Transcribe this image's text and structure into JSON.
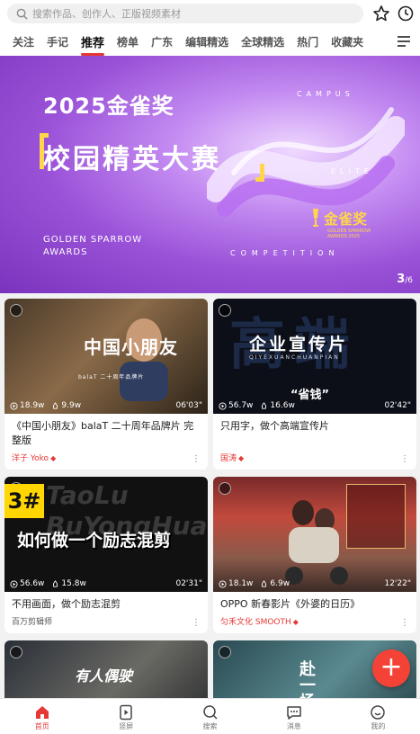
{
  "search": {
    "placeholder": "搜索作品、创作人、正版视频素材"
  },
  "tabs": [
    {
      "label": "关注"
    },
    {
      "label": "手记"
    },
    {
      "label": "推荐"
    },
    {
      "label": "榜单"
    },
    {
      "label": "广东"
    },
    {
      "label": "编辑精选"
    },
    {
      "label": "全球精选"
    },
    {
      "label": "热门"
    },
    {
      "label": "收藏夹"
    }
  ],
  "active_tab": "推荐",
  "banner": {
    "year_title": "2025金雀奖",
    "main_title": "校园精英大赛",
    "en_line1": "GOLDEN SPARROW",
    "en_line2": "AWARDS",
    "campus": "CAMPUS",
    "elite": "ELITE",
    "competition": "COMPETITION",
    "logo_cn": "金雀奖",
    "logo_en1": "GOLDEN SPARROW",
    "logo_en2": "AWARDS·2025",
    "page_current": "3",
    "page_total": "/6"
  },
  "cards": [
    {
      "overlay": "中国小朋友",
      "overlay_sub": "balaT 二十周年品牌片",
      "views": "18.9w",
      "likes": "9.9w",
      "duration": "06'03\"",
      "title": "《中国小朋友》balaT 二十周年品牌片 完整版",
      "author": "洋子 Yoko",
      "author_badge": true
    },
    {
      "overlay": "企业宣传片",
      "overlay_sub": "QIYEXUANCHUANPIAN",
      "overlay_big": "高端",
      "overlay_tag": "“省钱”",
      "views": "56.7w",
      "likes": "16.6w",
      "duration": "02'42\"",
      "title": "只用字，做个高端宣传片",
      "author": "国涛",
      "author_badge": true
    },
    {
      "overlay": "如何做一个励志混剪",
      "overlay_big": "TaoLu BuYongHuaMian",
      "overlay_num": "3#",
      "views": "56.6w",
      "likes": "15.8w",
      "duration": "02'31\"",
      "title": "不用画面，做个励志混剪",
      "author": "百万剪辑师",
      "author_badge": false
    },
    {
      "views": "18.1w",
      "likes": "6.9w",
      "duration": "12'22\"",
      "title": "OPPO 新春影片《外婆的日历》",
      "author": "匀禾文化 SMOOTH",
      "author_badge": true
    },
    {
      "overlay": "有人偶驶",
      "title": "",
      "author": ""
    },
    {
      "overlay": "赴一场"
    }
  ],
  "fab": {
    "label": "+"
  },
  "bottom_nav": [
    {
      "label": "首页",
      "icon": "home-icon"
    },
    {
      "label": "竖屏",
      "icon": "vertical-screen-icon"
    },
    {
      "label": "搜索",
      "icon": "search-icon"
    },
    {
      "label": "消息",
      "icon": "message-icon"
    },
    {
      "label": "我的",
      "icon": "profile-icon"
    }
  ],
  "colors": {
    "accent": "#e53935",
    "banner": "#9a52d8"
  }
}
